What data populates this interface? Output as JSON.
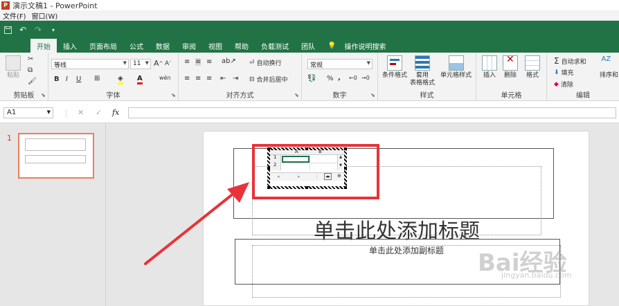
{
  "window": {
    "logo_letter": "P",
    "title": "演示文稿1 - PowerPoint"
  },
  "menu": [
    "文件(F)",
    "窗口(W)"
  ],
  "qat": {
    "save_icon": "save-icon",
    "undo_icon": "undo-icon",
    "redo_icon": "redo-icon"
  },
  "tabs": [
    "开始",
    "插入",
    "页面布局",
    "公式",
    "数据",
    "审阅",
    "视图",
    "帮助",
    "负载测试",
    "团队",
    "操作说明搜索"
  ],
  "ribbon": {
    "clipboard": {
      "label": "剪贴板",
      "paste": "粘贴"
    },
    "font": {
      "label": "字体",
      "font_name": "等线",
      "font_size": "11",
      "bold": "B",
      "italic": "I",
      "underline": "U",
      "wen": "wén",
      "grow": "A",
      "shrink": "A"
    },
    "alignment": {
      "label": "对齐方式",
      "wrap": "自动换行",
      "merge": "合并后居中"
    },
    "number": {
      "label": "数字",
      "format": "常规",
      "percent": "%",
      "comma": ","
    },
    "styles": {
      "label": "样式",
      "conditional": "条件格式",
      "table_line1": "套用",
      "table_line2": "表格格式",
      "cell_styles": "单元格样式"
    },
    "cells": {
      "label": "单元格",
      "insert": "插入",
      "delete": "删除",
      "format": "格式"
    },
    "editing": {
      "label": "编辑",
      "autosum": "自动求和",
      "fill": "填充",
      "clear": "清除",
      "sort": "排序和"
    }
  },
  "formula_bar": {
    "cell_ref": "A1",
    "fx": "fx"
  },
  "slides": {
    "current_number": "1"
  },
  "slide": {
    "title_placeholder": "单击此处添加标题",
    "subtitle_placeholder": "单击此处添加副标题"
  },
  "embed": {
    "col_a": "A",
    "col_b": "B",
    "row_1": "1",
    "row_2": "2"
  },
  "colors": {
    "excel_green": "#217346",
    "highlight_red": "#e8333a",
    "ppt_orange": "#c43e1c"
  },
  "watermark": {
    "main": "Bai经验",
    "sub": "jingyan.baidu.com"
  }
}
